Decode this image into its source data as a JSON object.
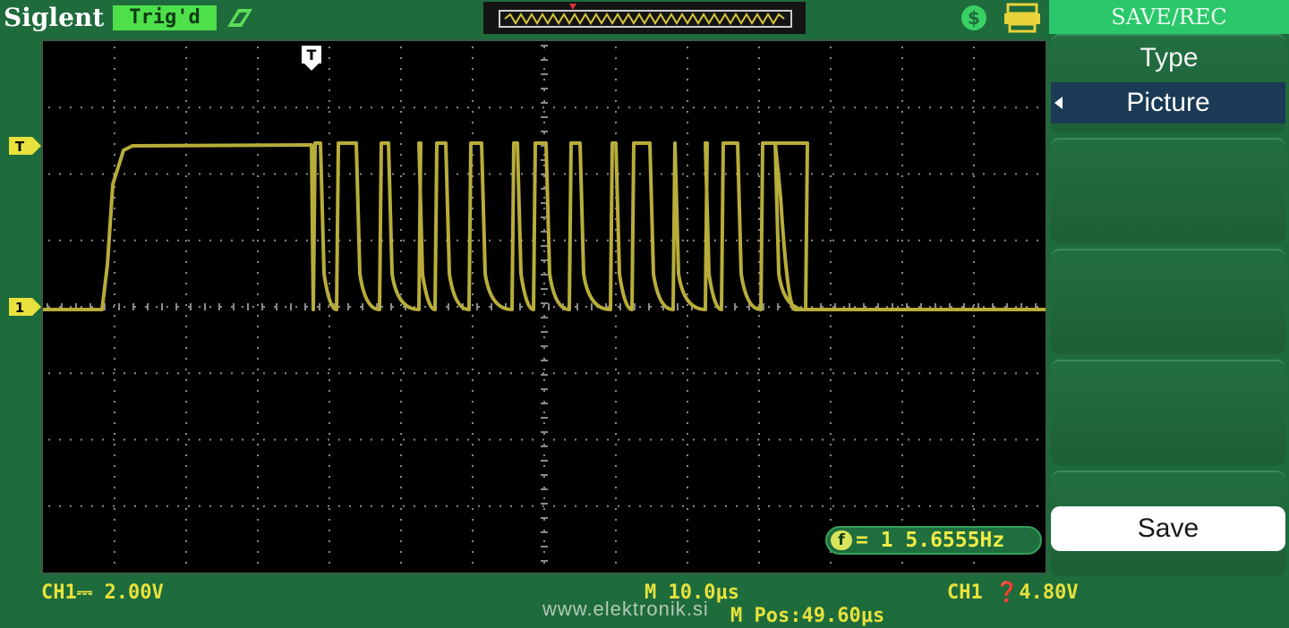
{
  "header": {
    "brand": "Siglent",
    "trigger_status": "Trig'd",
    "icons": [
      "run-icon",
      "usb-icon",
      "printer-icon"
    ]
  },
  "menu": {
    "title": "SAVE/REC",
    "type_label": "Type",
    "type_value": "Picture",
    "save_label": "Save"
  },
  "screen": {
    "trigger_marker": "T",
    "channel_marker": "1",
    "frequency_readout": "= 1 5.6555Hz"
  },
  "bottom": {
    "ch1_scale": "CH1⎓ 2.00V",
    "timebase": "M 10.0μs",
    "trigger_level": "CH1 ❓4.80V",
    "position": "M Pos:49.60μs",
    "watermark": "www.elektronik.si"
  },
  "colors": {
    "background": "#1e6b3c",
    "trace": "#b8ad3a",
    "readout": "#e8e23c",
    "menu_title": "#2ac86a",
    "selected": "#1a3a55"
  }
}
